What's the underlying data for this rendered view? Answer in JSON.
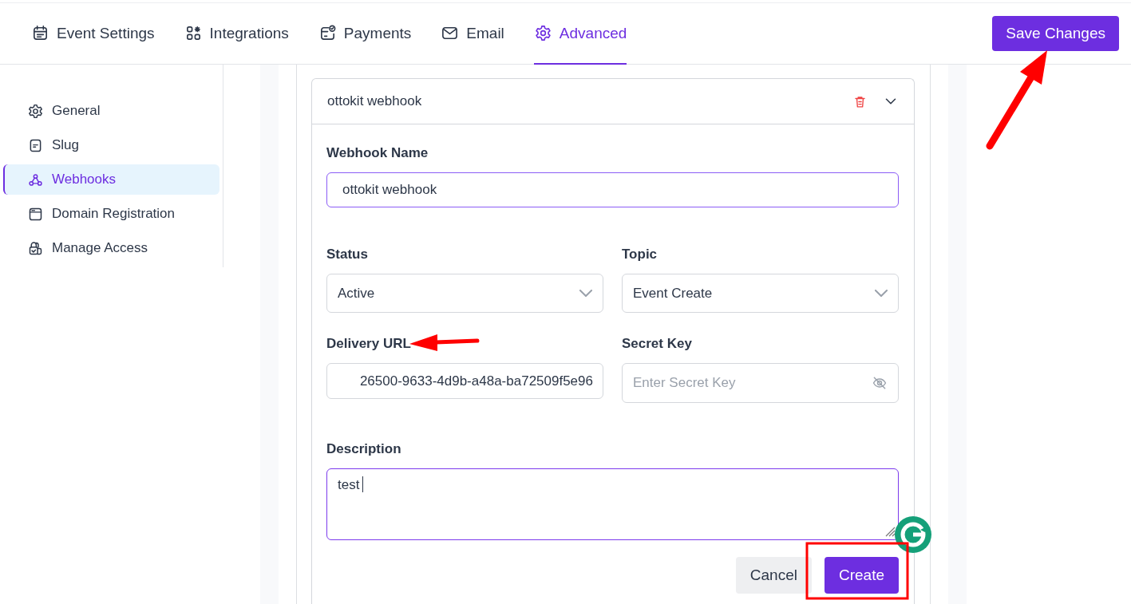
{
  "tabs": [
    {
      "label": "Event Settings",
      "selected": false
    },
    {
      "label": "Integrations",
      "selected": false
    },
    {
      "label": "Payments",
      "selected": false
    },
    {
      "label": "Email",
      "selected": false
    },
    {
      "label": "Advanced",
      "selected": true
    }
  ],
  "save_button": "Save Changes",
  "sidebar": {
    "items": [
      {
        "label": "General",
        "selected": false
      },
      {
        "label": "Slug",
        "selected": false
      },
      {
        "label": "Webhooks",
        "selected": true
      },
      {
        "label": "Domain Registration",
        "selected": false
      },
      {
        "label": "Manage Access",
        "selected": false
      }
    ]
  },
  "webhook": {
    "title": "ottokit webhook",
    "expanded": true,
    "name": {
      "label": "Webhook Name",
      "value": "ottokit webhook"
    },
    "status": {
      "label": "Status",
      "value": "Active"
    },
    "topic": {
      "label": "Topic",
      "value": "Event Create"
    },
    "delivery_url": {
      "label": "Delivery URL",
      "value": "26500-9633-4d9b-a48a-ba72509f5e96"
    },
    "secret_key": {
      "label": "Secret Key",
      "placeholder": "Enter Secret Key"
    },
    "description": {
      "label": "Description",
      "value": "test"
    },
    "buttons": [
      {
        "label": "Cancel",
        "kind": "secondary"
      },
      {
        "label": "Create",
        "kind": "primary"
      }
    ]
  },
  "annotations": [
    {
      "kind": "arrow"
    },
    {
      "kind": "arrow"
    },
    {
      "kind": "highlight_box"
    }
  ]
}
